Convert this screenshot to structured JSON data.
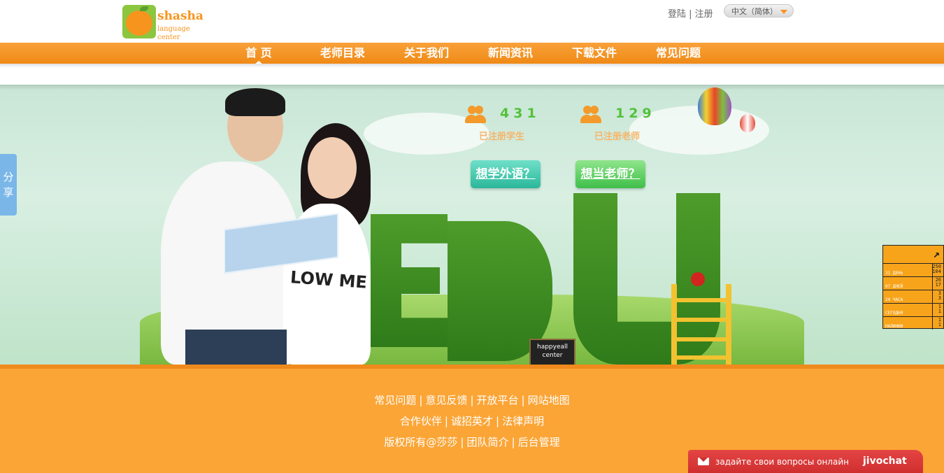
{
  "header": {
    "logo_name": "shasha",
    "logo_sub": "language center",
    "login": "登陆",
    "register": "注册",
    "language": "中文（简体）"
  },
  "nav": {
    "items": [
      {
        "label": "首 页"
      },
      {
        "label": "老师目录"
      },
      {
        "label": "关于我们"
      },
      {
        "label": "新闻资讯"
      },
      {
        "label": "下载文件"
      },
      {
        "label": "常见问题"
      }
    ]
  },
  "banner": {
    "students": {
      "count": "431",
      "label": "已注册学生"
    },
    "teachers": {
      "count": "129",
      "label": "已注册老师"
    },
    "cta_learn": "想学外语？",
    "cta_teach": "想当老师？",
    "shirt_text": "LOW ME",
    "chalkboard": "happyeall center"
  },
  "share": {
    "label1": "分",
    "label2": "享"
  },
  "counter": {
    "rows": [
      {
        "label": "31 ДЕНЬ",
        "v1": "250",
        "v2": "104"
      },
      {
        "label": "07 ДНЕЙ",
        "v1": "26",
        "v2": "17"
      },
      {
        "label": "24 ЧАСА",
        "v1": "3",
        "v2": "3"
      },
      {
        "label": "СЕГОДНЯ",
        "v1": "1",
        "v2": "1"
      },
      {
        "label": "НАЛИНИИ",
        "v1": "1",
        "v2": "1"
      }
    ]
  },
  "footer": {
    "row1": [
      "常见问题",
      "意见反馈",
      "开放平台",
      "网站地图"
    ],
    "row2": [
      "合作伙伴",
      "诚招英才",
      "法律声明"
    ],
    "row3": [
      "版权所有@莎莎",
      "团队简介",
      "后台管理"
    ]
  },
  "jivochat": {
    "text": "задайте свои вопросы онлайн",
    "brand": "jivochat"
  },
  "colors": {
    "brand_orange": "#f7941d",
    "accent_green": "#52c23a",
    "jivo_red": "#d93636"
  }
}
